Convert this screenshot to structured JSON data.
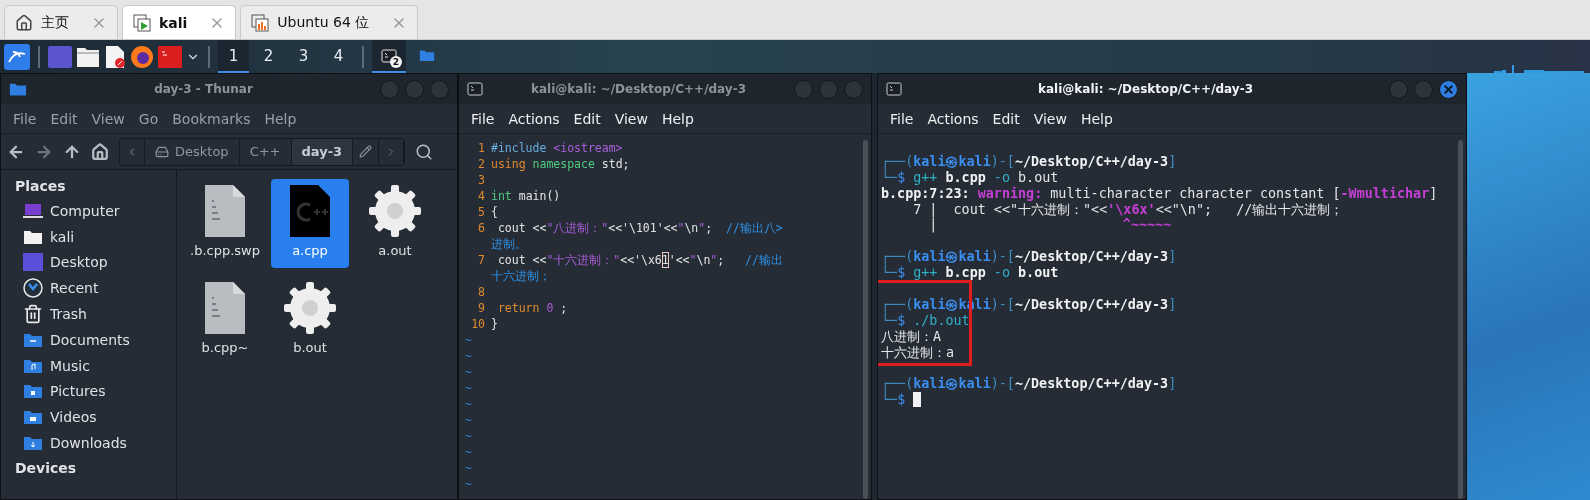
{
  "host_tabs": [
    {
      "label": "主页",
      "kind": "home",
      "selected": false
    },
    {
      "label": "kali",
      "kind": "vm",
      "selected": true
    },
    {
      "label": "Ubuntu 64 位",
      "kind": "vm-off",
      "selected": false
    }
  ],
  "taskbar": {
    "launchers": [
      {
        "kind": "kali"
      },
      {
        "kind": "desktop"
      },
      {
        "kind": "files"
      },
      {
        "kind": "editor"
      },
      {
        "kind": "browser"
      },
      {
        "kind": "terminal"
      }
    ],
    "workspaces": [
      {
        "label": "1",
        "selected": true
      },
      {
        "label": "2",
        "selected": false
      },
      {
        "label": "3",
        "selected": false
      },
      {
        "label": "4",
        "selected": false
      }
    ],
    "tasks": [
      {
        "kind": "terminal",
        "badge": "2",
        "selected": true
      },
      {
        "kind": "folder",
        "selected": false
      }
    ]
  },
  "file_manager": {
    "title": "day-3 - Thunar",
    "active": false,
    "menu": [
      "File",
      "Edit",
      "View",
      "Go",
      "Bookmarks",
      "Help"
    ],
    "path": [
      {
        "label": "Desktop",
        "kind": "drive",
        "selected": false
      },
      {
        "label": "C++",
        "kind": "plain",
        "selected": false
      },
      {
        "label": "day-3",
        "kind": "plain",
        "selected": true
      }
    ],
    "sidebar": {
      "heading": "Places",
      "items": [
        {
          "label": "Computer",
          "kind": "computer"
        },
        {
          "label": "kali",
          "kind": "home"
        },
        {
          "label": "Desktop",
          "kind": "desktop"
        },
        {
          "label": "Recent",
          "kind": "recent"
        },
        {
          "label": "Trash",
          "kind": "trash"
        },
        {
          "label": "Documents",
          "kind": "documents"
        },
        {
          "label": "Music",
          "kind": "music"
        },
        {
          "label": "Pictures",
          "kind": "pictures"
        },
        {
          "label": "Videos",
          "kind": "videos"
        },
        {
          "label": "Downloads",
          "kind": "downloads"
        }
      ],
      "heading_2": "Devices"
    },
    "files": [
      {
        "name": ".b.cpp.swp",
        "kind": "binary",
        "selected": false
      },
      {
        "name": "a.cpp",
        "kind": "cpp",
        "selected": true
      },
      {
        "name": "a.out",
        "kind": "executable",
        "selected": false
      },
      {
        "name": "b.cpp~",
        "kind": "binary",
        "selected": false
      },
      {
        "name": "b.out",
        "kind": "executable",
        "selected": false
      }
    ]
  },
  "editor": {
    "title": "kali@kali: ~/Desktop/C++/day-3",
    "active": false,
    "menu": [
      "File",
      "Actions",
      "Edit",
      "View",
      "Help"
    ],
    "rows": [
      {
        "number": "1",
        "segments": [
          {
            "kind": "preproc",
            "text": "#include "
          },
          {
            "kind": "string",
            "text": "<iostream>"
          }
        ]
      },
      {
        "number": "2",
        "segments": [
          {
            "kind": "keyword",
            "text": "using "
          },
          {
            "kind": "type",
            "text": "namespace"
          },
          {
            "kind": "plain",
            "text": " std;"
          }
        ]
      },
      {
        "number": "3",
        "segments": []
      },
      {
        "number": "4",
        "segments": [
          {
            "kind": "type",
            "text": "int"
          },
          {
            "kind": "plain",
            "text": " main()"
          }
        ]
      },
      {
        "number": "5",
        "segments": [
          {
            "kind": "plain",
            "text": "{"
          }
        ]
      },
      {
        "number": "6",
        "segments": [
          {
            "kind": "plain",
            "text": " cout <<"
          },
          {
            "kind": "string",
            "text": "\"八进制：\""
          },
          {
            "kind": "plain",
            "text": "<<'\\101'<<"
          },
          {
            "kind": "string",
            "text": "\""
          },
          {
            "kind": "plain",
            "text": "\\n"
          },
          {
            "kind": "string",
            "text": "\""
          },
          {
            "kind": "plain",
            "text": ";  "
          },
          {
            "kind": "comment",
            "text": "//输出八>"
          }
        ]
      },
      {
        "segments": [
          {
            "kind": "comment",
            "text": "进制。"
          }
        ]
      },
      {
        "number": "7",
        "segments": [
          {
            "kind": "plain",
            "text": " cout <<"
          },
          {
            "kind": "string",
            "text": "\"十六进制：\""
          },
          {
            "kind": "plain",
            "text": "<<'\\x6"
          },
          {
            "kind": "cursor",
            "text": "1"
          },
          {
            "kind": "plain",
            "text": "'<<"
          },
          {
            "kind": "string",
            "text": "\""
          },
          {
            "kind": "plain",
            "text": "\\n"
          },
          {
            "kind": "string",
            "text": "\""
          },
          {
            "kind": "plain",
            "text": ";   "
          },
          {
            "kind": "comment",
            "text": "//输出"
          }
        ]
      },
      {
        "segments": [
          {
            "kind": "comment",
            "text": "十六进制；"
          }
        ]
      },
      {
        "number": "8",
        "segments": []
      },
      {
        "number": "9",
        "segments": [
          {
            "kind": "keyword",
            "text": " return"
          },
          {
            "kind": "string",
            "text": " 0"
          },
          {
            "kind": "plain",
            "text": " ;"
          }
        ]
      },
      {
        "number": "10",
        "segments": [
          {
            "kind": "plain",
            "text": "}"
          }
        ]
      }
    ],
    "tildes": [
      "~",
      "~",
      "~",
      "~",
      "~",
      "~",
      "~",
      "~",
      "~",
      "~"
    ]
  },
  "terminal": {
    "title": "kali@kali: ~/Desktop/C++/day-3",
    "active": true,
    "menu": [
      "File",
      "Actions",
      "Edit",
      "View",
      "Help"
    ],
    "rows": [
      {
        "kind": "blank"
      },
      {
        "kind": "line",
        "segments": [
          {
            "kind": "frame",
            "text": "┌──("
          },
          {
            "kind": "user",
            "text": "kali㉿kali"
          },
          {
            "kind": "frame",
            "text": ")-["
          },
          {
            "kind": "path",
            "text": "~/Desktop/C++/day-3"
          },
          {
            "kind": "frame",
            "text": "]"
          }
        ]
      },
      {
        "kind": "line",
        "segments": [
          {
            "kind": "frame",
            "text": "└─"
          },
          {
            "kind": "dollar",
            "text": "$ "
          },
          {
            "kind": "command",
            "text": "g++ "
          },
          {
            "kind": "bold",
            "text": "b.cpp"
          },
          {
            "kind": "command",
            "text": " -o"
          },
          {
            "kind": "plain",
            "text": " b.out"
          }
        ]
      },
      {
        "kind": "line",
        "segments": [
          {
            "kind": "bold",
            "text": "b.cpp:7:23: "
          },
          {
            "kind": "warning",
            "text": "warning:"
          },
          {
            "kind": "plain",
            "text": " multi-character character constant ["
          },
          {
            "kind": "warning",
            "text": "-Wmultichar"
          },
          {
            "kind": "plain",
            "text": "]"
          }
        ]
      },
      {
        "kind": "line",
        "segments": [
          {
            "kind": "plain",
            "text": "    7 |  cout <<\"十六进制：\"<<"
          },
          {
            "kind": "warning",
            "text": "'\\x6x'"
          },
          {
            "kind": "plain",
            "text": "<<\"\\n\";   //输出十六进制；"
          }
        ]
      },
      {
        "kind": "line",
        "segments": [
          {
            "kind": "plain",
            "text": "      |"
          },
          {
            "kind": "warning",
            "text": "                       ^~~~~~"
          }
        ]
      },
      {
        "kind": "blank"
      },
      {
        "kind": "line",
        "segments": [
          {
            "kind": "frame",
            "text": "┌──("
          },
          {
            "kind": "user",
            "text": "kali㉿kali"
          },
          {
            "kind": "frame",
            "text": ")-["
          },
          {
            "kind": "path",
            "text": "~/Desktop/C++/day-3"
          },
          {
            "kind": "frame",
            "text": "]"
          }
        ]
      },
      {
        "kind": "line",
        "segments": [
          {
            "kind": "frame",
            "text": "└─"
          },
          {
            "kind": "dollar",
            "text": "$ "
          },
          {
            "kind": "command",
            "text": "g++ "
          },
          {
            "kind": "bold",
            "text": "b.cpp"
          },
          {
            "kind": "command",
            "text": " -o "
          },
          {
            "kind": "bold",
            "text": "b.out"
          }
        ]
      },
      {
        "kind": "blank"
      },
      {
        "kind": "line",
        "segments": [
          {
            "kind": "frame",
            "text": "┌──("
          },
          {
            "kind": "user",
            "text": "kali㉿kali"
          },
          {
            "kind": "frame",
            "text": ")-["
          },
          {
            "kind": "path",
            "text": "~/Desktop/C++/day-3"
          },
          {
            "kind": "frame",
            "text": "]"
          }
        ]
      },
      {
        "kind": "line",
        "segments": [
          {
            "kind": "frame",
            "text": "└─"
          },
          {
            "kind": "dollar",
            "text": "$ "
          },
          {
            "kind": "command",
            "text": "./b.out"
          }
        ]
      },
      {
        "kind": "line",
        "segments": [
          {
            "kind": "plain",
            "text": "八进制：A"
          }
        ]
      },
      {
        "kind": "line",
        "segments": [
          {
            "kind": "plain",
            "text": "十六进制：a"
          }
        ]
      },
      {
        "kind": "blank"
      },
      {
        "kind": "line",
        "segments": [
          {
            "kind": "frame",
            "text": "┌──("
          },
          {
            "kind": "user",
            "text": "kali㉿kali"
          },
          {
            "kind": "frame",
            "text": ")-["
          },
          {
            "kind": "path",
            "text": "~/Desktop/C++/day-3"
          },
          {
            "kind": "frame",
            "text": "]"
          }
        ]
      },
      {
        "kind": "line",
        "cursor": true,
        "segments": [
          {
            "kind": "frame",
            "text": "└─"
          },
          {
            "kind": "dollar",
            "text": "$ "
          }
        ]
      }
    ]
  }
}
